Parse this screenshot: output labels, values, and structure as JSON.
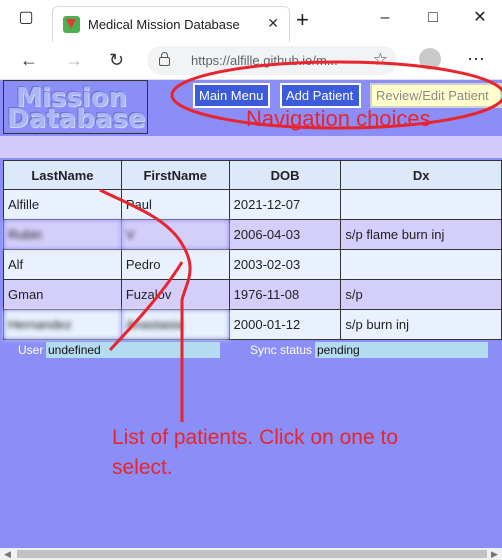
{
  "browser": {
    "tab_title": "Medical Mission Database",
    "url": "https://alfille.github.io/m..."
  },
  "app": {
    "logo_line1": "Mission",
    "logo_line2": "Database",
    "nav": {
      "main_menu": "Main Menu",
      "add_patient": "Add Patient",
      "review_edit": "Review/Edit Patient"
    },
    "table": {
      "headers": [
        "LastName",
        "FirstName",
        "DOB",
        "Dx"
      ],
      "rows": [
        {
          "last": "Alfille",
          "first": "Paul",
          "dob": "2021-12-07",
          "dx": ""
        },
        {
          "last": "Rubin",
          "first": "V",
          "dob": "2006-04-03",
          "dx": "s/p flame burn inj"
        },
        {
          "last": "Alf",
          "first": "Pedro",
          "dob": "2003-02-03",
          "dx": ""
        },
        {
          "last": "Gman",
          "first": "Fuzalov",
          "dob": "1976-11-08",
          "dx": "s/p"
        },
        {
          "last": "Hernandez",
          "first": "Anastasia",
          "dob": "2000-01-12",
          "dx": "s/p burn inj"
        }
      ]
    },
    "status": {
      "user_label": "User",
      "user_value": "undefined",
      "sync_label": "Sync status",
      "sync_value": "pending"
    }
  },
  "annotations": {
    "navigation": "Navigation choices",
    "list": "List of patients. Click on one to select.",
    "color": "#e8242e"
  }
}
